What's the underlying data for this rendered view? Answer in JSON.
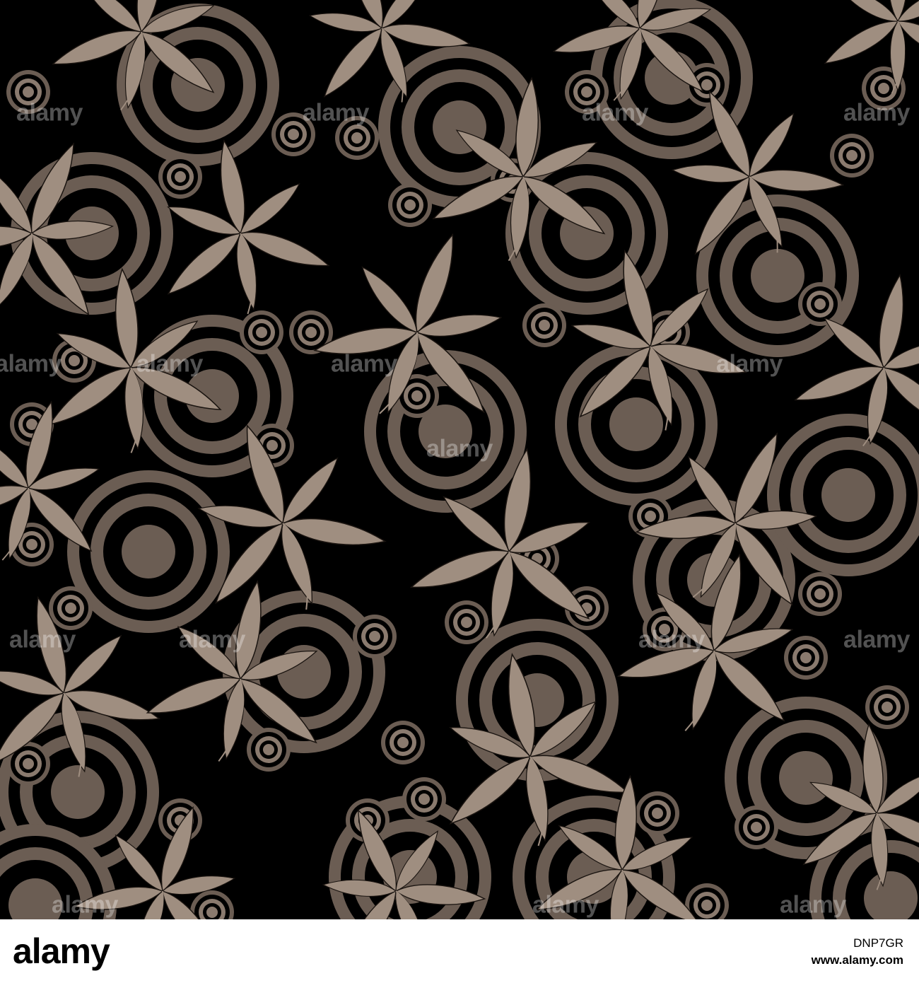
{
  "image": {
    "description_colors": {
      "background": "#000000",
      "leaf_fill": "#9f8e80",
      "leaf_stroke": "#1a1410",
      "ring_fill": "#6b5d53",
      "ring_light": "#8a7a6e"
    },
    "watermark_text": "alamy"
  },
  "footer": {
    "logo": "alamy",
    "image_id": "DNP7GR",
    "url": "www.alamy.com"
  }
}
